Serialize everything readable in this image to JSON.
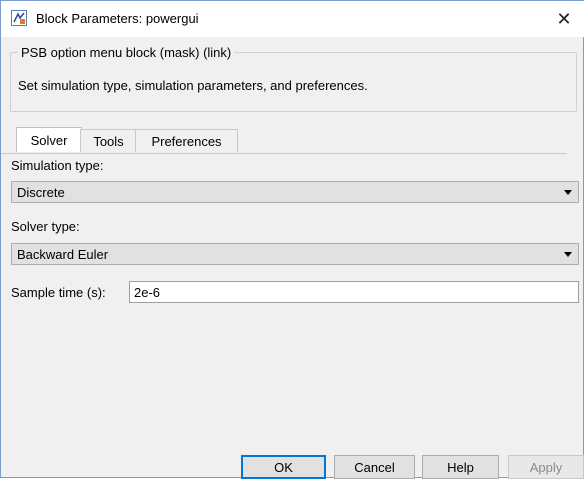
{
  "window": {
    "title": "Block Parameters: powergui",
    "close_glyph": "✕"
  },
  "group": {
    "legend": "PSB option menu block (mask) (link)",
    "description": "Set simulation type, simulation parameters, and preferences."
  },
  "tabs": [
    {
      "label": "Solver",
      "active": true
    },
    {
      "label": "Tools",
      "active": false
    },
    {
      "label": "Preferences",
      "active": false
    }
  ],
  "solver": {
    "simulation_type_label": "Simulation type:",
    "simulation_type_value": "Discrete",
    "solver_type_label": "Solver type:",
    "solver_type_value": "Backward Euler",
    "sample_time_label": "Sample time (s):",
    "sample_time_value": "2e-6"
  },
  "buttons": {
    "ok": "OK",
    "cancel": "Cancel",
    "help": "Help",
    "apply": "Apply"
  },
  "colors": {
    "accent": "#0078d7",
    "window_bg": "#f0f0f0",
    "border": "#7a9cc9"
  },
  "icons": {
    "app": "simulink-block-icon",
    "close": "close-icon",
    "dropdown": "chevron-down-icon"
  }
}
